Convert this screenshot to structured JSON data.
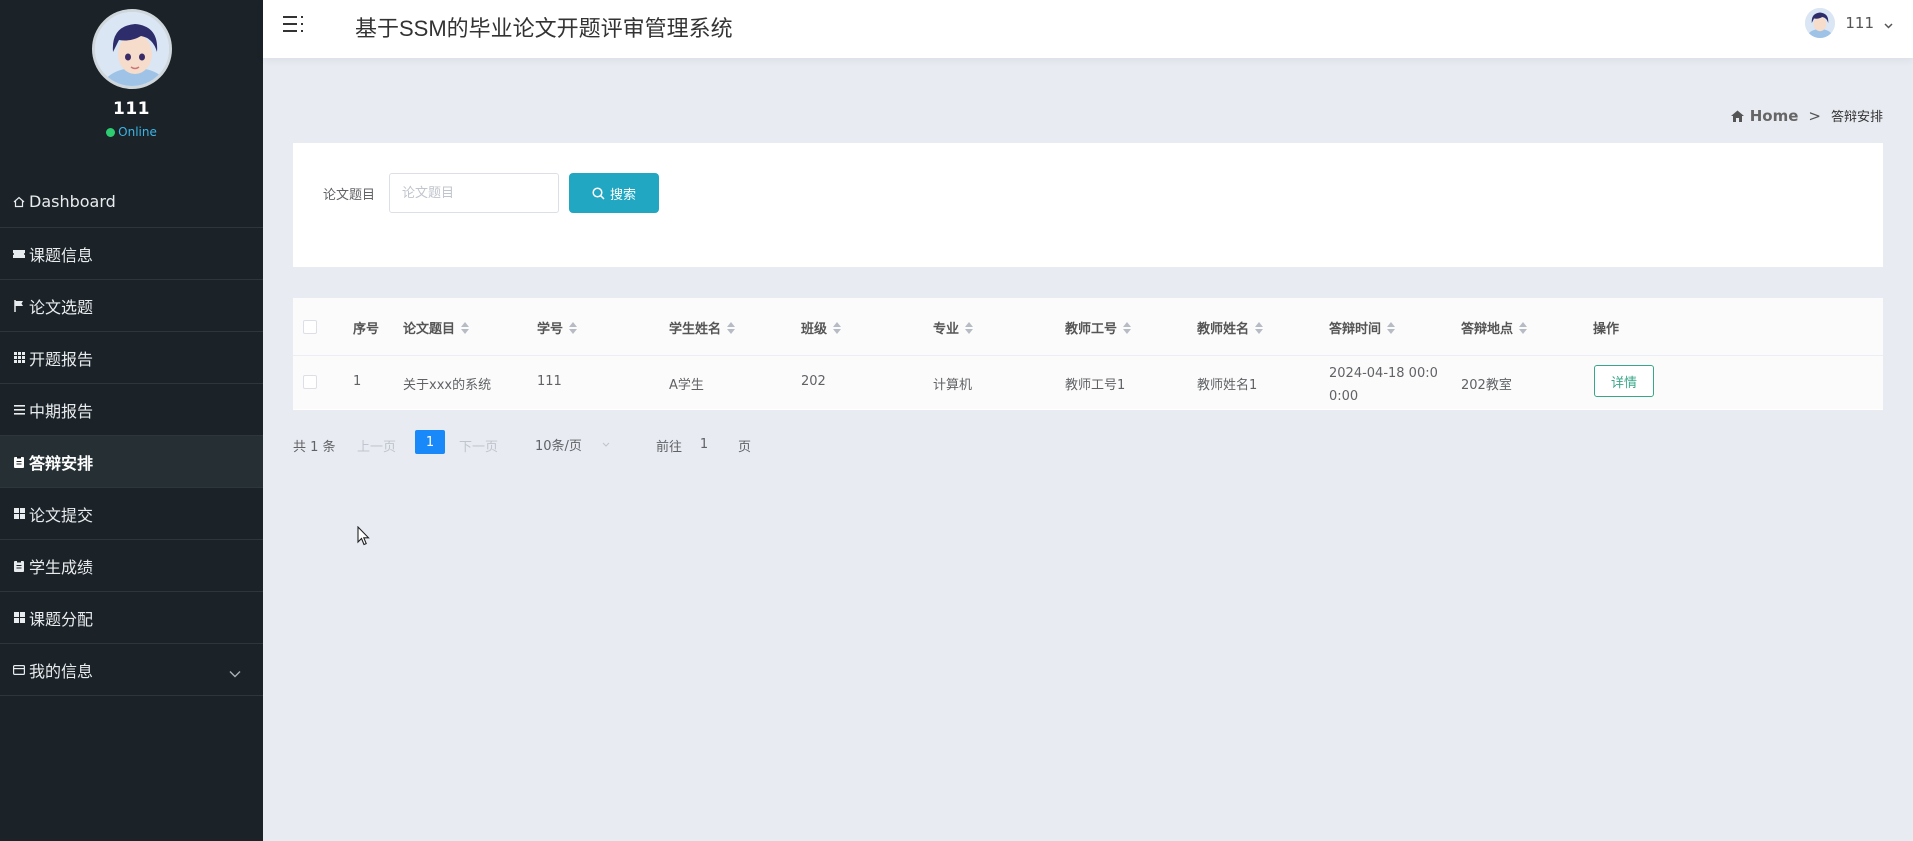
{
  "app": {
    "title": "基于SSM的毕业论文开题评审管理系统"
  },
  "user": {
    "name": "111",
    "status": "Online"
  },
  "sidebar": {
    "items": [
      {
        "label": "Dashboard",
        "icon": "home-icon"
      },
      {
        "label": "课题信息",
        "icon": "ticket-icon"
      },
      {
        "label": "论文选题",
        "icon": "flag-icon"
      },
      {
        "label": "开题报告",
        "icon": "grid-icon"
      },
      {
        "label": "中期报告",
        "icon": "list-icon"
      },
      {
        "label": "答辩安排",
        "icon": "clipboard-icon",
        "active": true
      },
      {
        "label": "论文提交",
        "icon": "grid-icon"
      },
      {
        "label": "学生成绩",
        "icon": "clipboard-icon"
      },
      {
        "label": "课题分配",
        "icon": "grid-icon"
      },
      {
        "label": "我的信息",
        "icon": "card-icon",
        "expandable": true
      }
    ]
  },
  "breadcrumb": {
    "home": "Home",
    "separator": ">",
    "current": "答辩安排"
  },
  "search": {
    "label": "论文题目",
    "placeholder": "论文题目",
    "button": "搜索"
  },
  "table": {
    "columns": [
      "序号",
      "论文题目",
      "学号",
      "学生姓名",
      "班级",
      "专业",
      "教师工号",
      "教师姓名",
      "答辩时间",
      "答辩地点",
      "操作"
    ],
    "rows": [
      {
        "index": "1",
        "title": "关于xxx的系统",
        "student_no": "111",
        "student_name": "A学生",
        "class": "202",
        "major": "计算机",
        "teacher_no": "教师工号1",
        "teacher_name": "教师姓名1",
        "defense_time_line1": "2024-04-18 00:0",
        "defense_time_line2": "0:00",
        "location": "202教室",
        "action": "详情"
      }
    ]
  },
  "pagination": {
    "total": "共 1 条",
    "prev": "上一页",
    "current": "1",
    "next": "下一页",
    "page_size": "10条/页",
    "goto_prefix": "前往",
    "goto_value": "1",
    "goto_suffix": "页"
  },
  "colors": {
    "sidebar_bg": "#1b2328",
    "accent": "#22a7c2",
    "page_active": "#1989fa",
    "detail": "#3aa688"
  }
}
